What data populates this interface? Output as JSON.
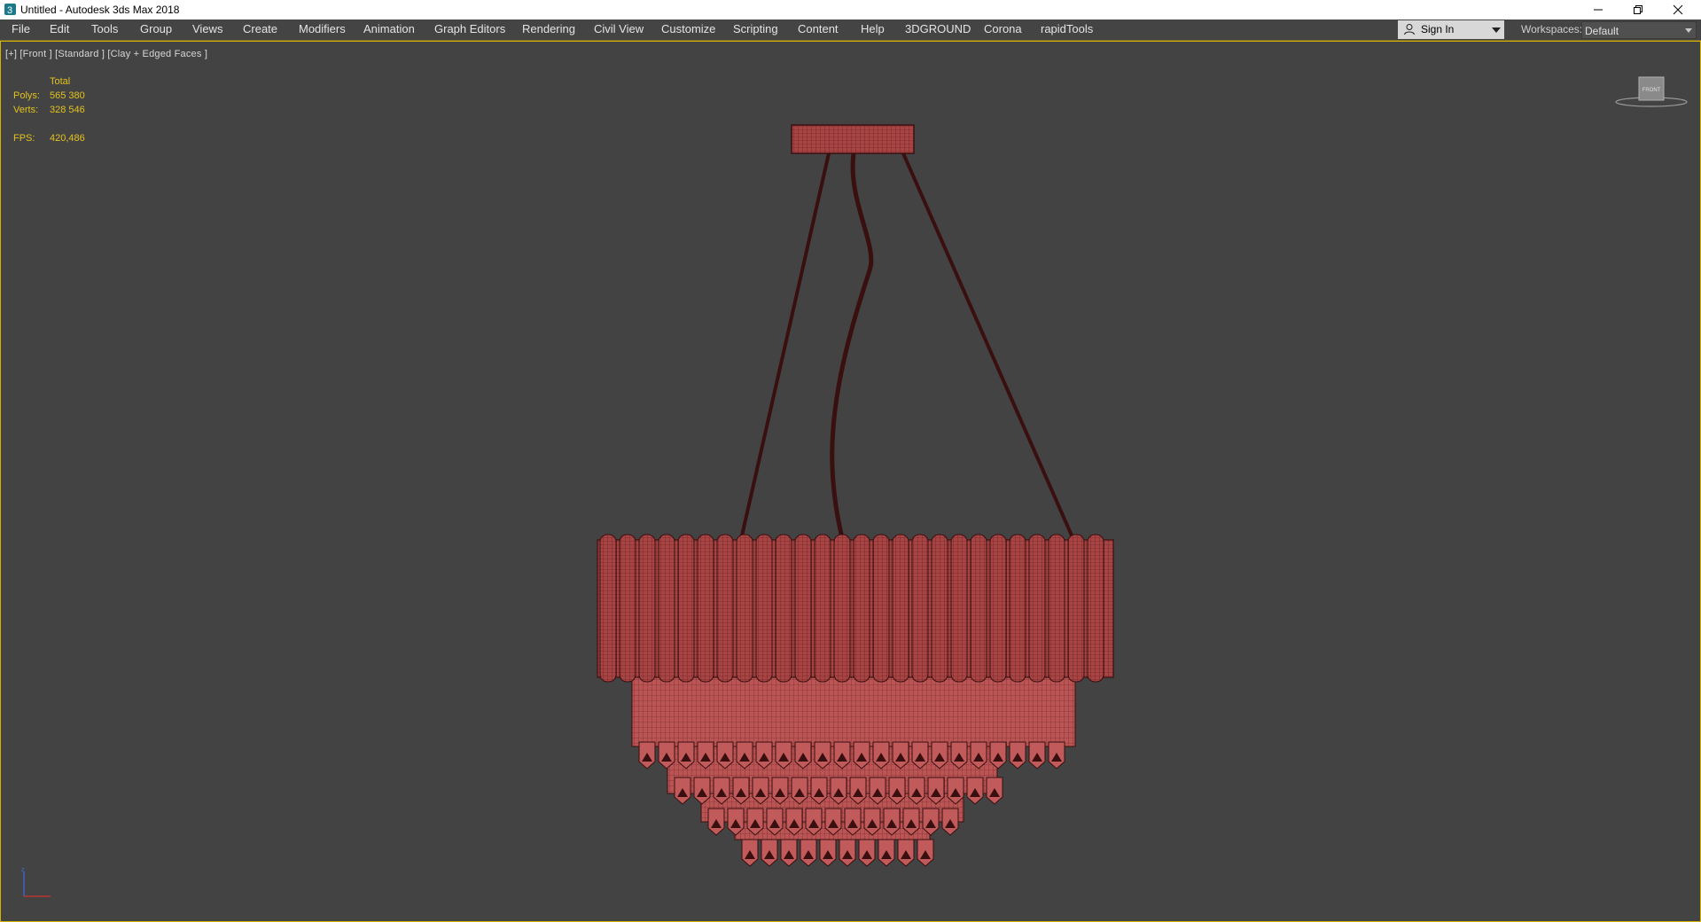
{
  "window": {
    "title": "Untitled - Autodesk 3ds Max 2018",
    "controls": [
      "minimize-icon",
      "restore-icon",
      "close-icon"
    ]
  },
  "menubar": {
    "items": [
      {
        "label": "File"
      },
      {
        "label": "Edit"
      },
      {
        "label": "Tools"
      },
      {
        "label": "Group"
      },
      {
        "label": "Views"
      },
      {
        "label": "Create"
      },
      {
        "label": "Modifiers"
      },
      {
        "label": "Animation"
      },
      {
        "label": "Graph Editors"
      },
      {
        "label": "Rendering"
      },
      {
        "label": "Civil View"
      },
      {
        "label": "Customize"
      },
      {
        "label": "Scripting"
      },
      {
        "label": "Content"
      },
      {
        "label": "Help"
      },
      {
        "label": "3DGROUND"
      },
      {
        "label": "Corona"
      },
      {
        "label": "rapidTools"
      }
    ],
    "sign_in_label": "Sign In",
    "workspaces_label": "Workspaces:",
    "workspace_value": "Default"
  },
  "viewport": {
    "label": "[+] [Front ] [Standard ] [Clay + Edged Faces ]",
    "stats": {
      "total_label": "Total",
      "polys_label": "Polys:",
      "polys_value": "565 380",
      "verts_label": "Verts:",
      "verts_value": "328 546",
      "fps_label": "FPS:",
      "fps_value": "420,486"
    },
    "viewcube_face": "FRONT",
    "model_color": "#b24a4a",
    "wire_color": "#3a0f0f",
    "stats_color": "#e3c21c"
  }
}
